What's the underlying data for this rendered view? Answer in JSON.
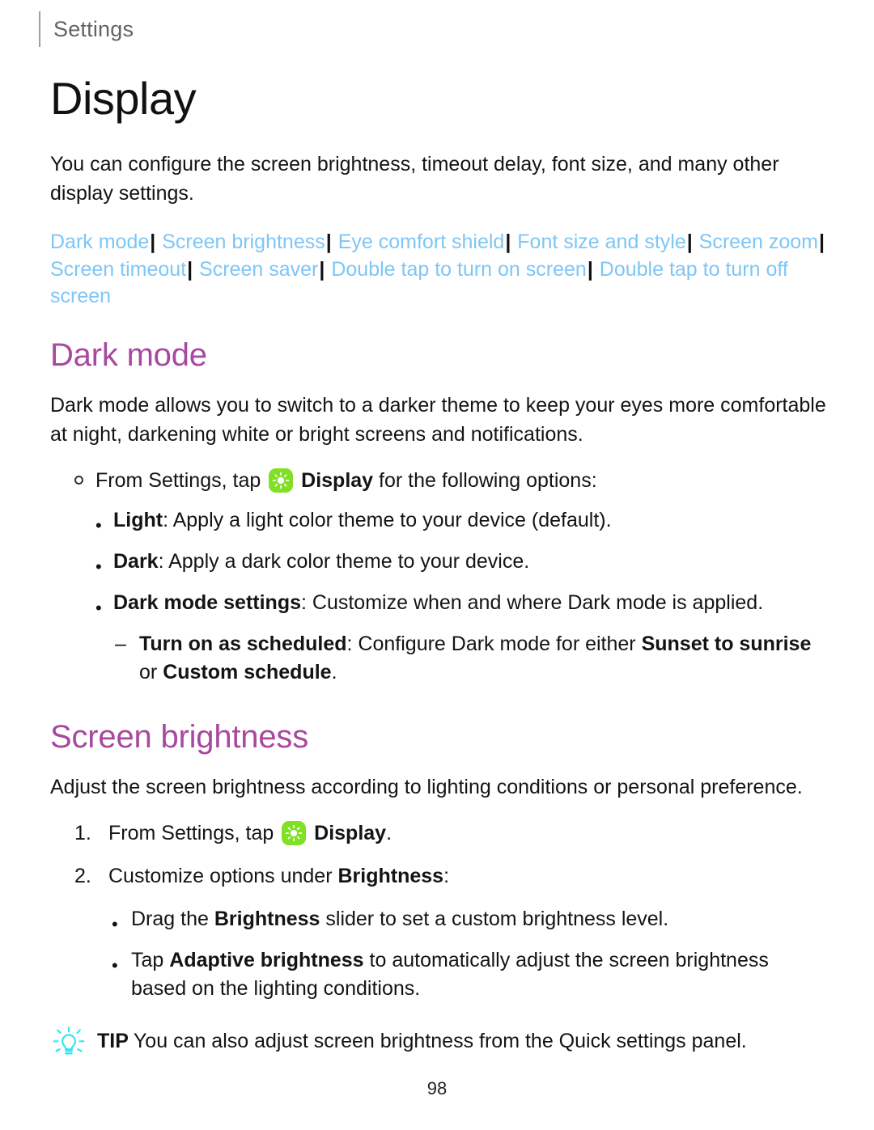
{
  "header": {
    "running_title": "Settings"
  },
  "page_title": "Display",
  "intro": "You can configure the screen brightness, timeout delay, font size, and many other display settings.",
  "link_bar": {
    "separator": "|",
    "links": [
      "Dark mode",
      "Screen brightness",
      "Eye comfort shield",
      "Font size and style",
      "Screen zoom",
      "Screen timeout",
      "Screen saver",
      "Double tap to turn on screen",
      "Double tap to turn off screen"
    ]
  },
  "sections": [
    {
      "title": "Dark mode",
      "body": "Dark mode allows you to switch to a darker theme to keep your eyes more comfortable at night, darkening white or bright screens and notifications.",
      "step_prefix": "From Settings, tap",
      "step_app": "Display",
      "step_suffix": "for the following options:",
      "options": [
        {
          "term": "Light",
          "desc": ": Apply a light color theme to your device (default)."
        },
        {
          "term": "Dark",
          "desc": ": Apply a dark color theme to your device."
        },
        {
          "term": "Dark mode settings",
          "desc": ": Customize when and where Dark mode is applied."
        }
      ],
      "sub_option": {
        "term": "Turn on as scheduled",
        "desc_a": ": Configure Dark mode for either ",
        "bold_a": "Sunset to sunrise",
        "desc_b": " or ",
        "bold_b": "Custom schedule",
        "desc_c": "."
      }
    },
    {
      "title": "Screen brightness",
      "body": "Adjust the screen brightness according to lighting conditions or personal preference.",
      "steps": [
        {
          "number": "1.",
          "prefix": "From Settings, tap",
          "app": "Display",
          "suffix": "."
        },
        {
          "number": "2.",
          "prefix": "Customize options under",
          "bold": "Brightness",
          "suffix": ":"
        }
      ],
      "step_bullets": [
        {
          "pre": "Drag the ",
          "bold": "Brightness",
          "post": " slider to set a custom brightness level."
        },
        {
          "pre": "Tap ",
          "bold": "Adaptive brightness",
          "post": " to automatically adjust the screen brightness based on the lighting conditions."
        }
      ]
    }
  ],
  "tip": {
    "label": "TIP",
    "text": "You can also adjust screen brightness from the Quick settings panel."
  },
  "page_number": "98",
  "colors": {
    "link": "#7ec6f5",
    "heading": "#a8489f",
    "app_icon_green": "#80e024",
    "tip_icon_cyan": "#2ee8f0",
    "text": "#141414",
    "running_header": "#5f6368"
  }
}
